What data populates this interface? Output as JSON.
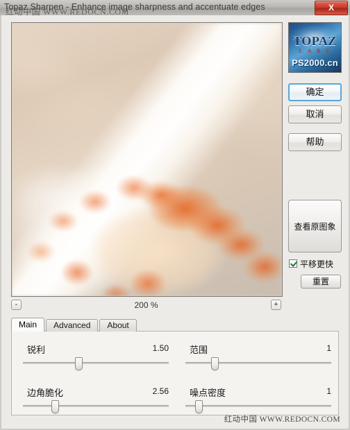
{
  "window": {
    "title": "Topaz Sharpen - Enhance image sharpness and accentuate edges",
    "close_label": "X"
  },
  "watermarks": {
    "top": "红动中国 WWW.REDOCN.COM",
    "bottom": "红动中国 WWW.REDOCN.COM"
  },
  "preview": {
    "alt": "blurred seashell on sand"
  },
  "zoom": {
    "minus_label": "-",
    "plus_label": "+",
    "value": "200 %"
  },
  "logo": {
    "brand": "TOPAZ",
    "sub": "L A B S",
    "site": "PS2000.cn"
  },
  "buttons": {
    "ok": "确定",
    "cancel": "取消",
    "help": "帮助",
    "view_original": "查看原图象",
    "reset": "重置"
  },
  "checkbox": {
    "pan_faster": "平移更快",
    "checked": true
  },
  "tabs": [
    {
      "label": "Main",
      "active": true
    },
    {
      "label": "Advanced",
      "active": false
    },
    {
      "label": "About",
      "active": false
    }
  ],
  "sliders": [
    {
      "label": "锐利",
      "value": "1.50",
      "percent": 38
    },
    {
      "label": "范围",
      "value": "1",
      "percent": 20
    },
    {
      "label": "边角脆化",
      "value": "2.56",
      "percent": 22
    },
    {
      "label": "噪点密度",
      "value": "1",
      "percent": 9
    }
  ],
  "colors": {
    "accent": "#5aa6d8",
    "close": "#c83a2c",
    "panel_bg": "#f4f3f0",
    "window_bg": "#ecebe7",
    "logo_blue": "#2f6ea8",
    "logo_red": "#b23a22"
  }
}
